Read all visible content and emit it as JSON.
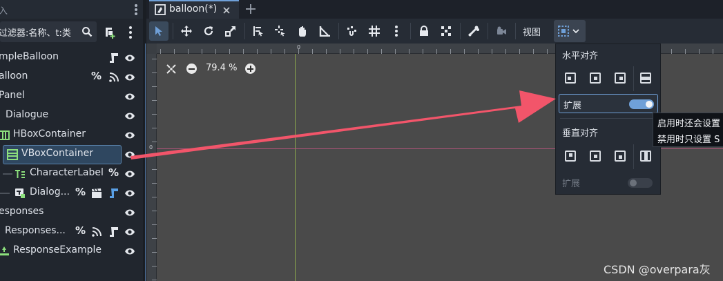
{
  "scene_dock": {
    "title": "入",
    "filter": {
      "value": "过滤器:名称、t:类"
    },
    "icons": {
      "search": "search-icon",
      "add_script": "script-plus-icon",
      "menu": "kebab-menu-icon"
    },
    "tree": [
      {
        "label": "mpleBalloon",
        "badges": [
          "script-icon"
        ],
        "visible": true
      },
      {
        "label": "alloon",
        "badges": [
          "unique-name-percent",
          "signal-icon"
        ],
        "visible": true
      },
      {
        "label": "Panel",
        "badges": [],
        "visible": true
      },
      {
        "label": "Dialogue",
        "badges": [],
        "visible": true
      },
      {
        "label": "HBoxContainer",
        "badges": [],
        "visible": true
      },
      {
        "label": "VBoxContainer",
        "badges": [],
        "visible": true,
        "selected": true
      },
      {
        "label": "CharacterLabel",
        "badges": [
          "unique-name-percent"
        ],
        "visible": true
      },
      {
        "label": "Dialog...",
        "badges": [
          "unique-name-percent",
          "clapper-icon",
          "script-icon"
        ],
        "visible": true
      },
      {
        "label": "esponses",
        "badges": [],
        "visible": true
      },
      {
        "label": "Responses...",
        "badges": [
          "unique-name-percent",
          "signal-icon",
          "script-icon"
        ],
        "visible": true
      },
      {
        "label": "ResponseExample",
        "badges": [],
        "visible": true
      }
    ],
    "percent_symbol": "%"
  },
  "editor_tabs": {
    "tabs": [
      {
        "label": "balloon(*)",
        "active": true
      }
    ],
    "add_tab_icon": "plus-icon"
  },
  "toolbar": {
    "view_label": "视图",
    "tools": [
      "select-icon",
      "move-icon",
      "rotate-icon",
      "scale-icon",
      "list-select-icon",
      "pivot-icon",
      "pan-hand-icon",
      "ruler-icon",
      "smart-snap-icon",
      "grid-snap-icon",
      "more-icon",
      "lock-icon",
      "group-icon",
      "skeleton-icon",
      "camera-icon",
      "anchor-layout-icon"
    ]
  },
  "viewport": {
    "zoom": "79.4 %",
    "ruler_origin": "0",
    "colors": {
      "background": "#4a4a4a",
      "y_axis": "#8aa64d",
      "x_axis": "#b0557a"
    }
  },
  "layout_popup": {
    "horizontal_header": "水平对齐",
    "horizontal_expand_label": "扩展",
    "horizontal_expand_on": true,
    "vertical_header": "垂直对齐",
    "vertical_expand_label": "扩展",
    "vertical_expand_on": false
  },
  "tooltip": {
    "line1": "启用时还会设置",
    "line2": "禁用时只设置 S"
  },
  "watermark": "CSDN @overpara灰",
  "colors": {
    "accent": "#6fa0d8",
    "arrow": "#f2556a",
    "selection": "#2f4760"
  }
}
